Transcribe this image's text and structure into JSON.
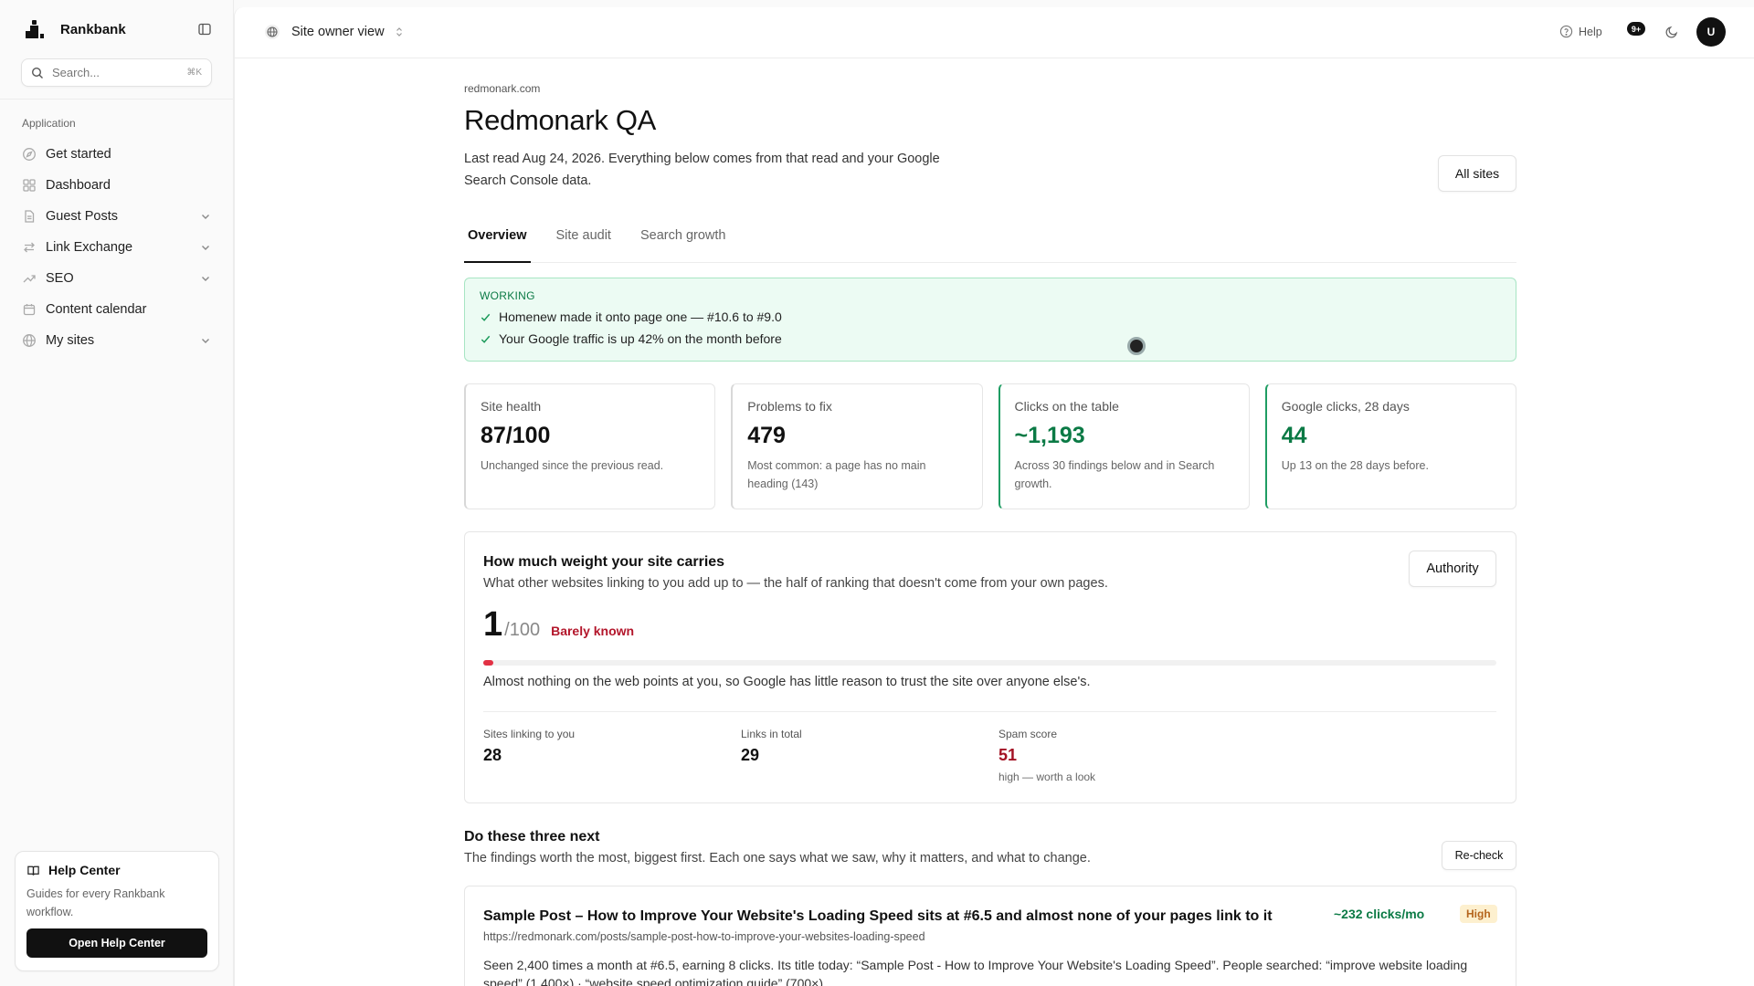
{
  "sidebar": {
    "brand": "Rankbank",
    "search": {
      "placeholder": "Search...",
      "shortcut": "⌘K"
    },
    "group_label": "Application",
    "items": [
      {
        "label": "Get started",
        "icon": "compass-icon",
        "expandable": false
      },
      {
        "label": "Dashboard",
        "icon": "grid-icon",
        "expandable": false
      },
      {
        "label": "Guest Posts",
        "icon": "document-icon",
        "expandable": true
      },
      {
        "label": "Link Exchange",
        "icon": "swap-icon",
        "expandable": true
      },
      {
        "label": "SEO",
        "icon": "trend-up-icon",
        "expandable": true
      },
      {
        "label": "Content calendar",
        "icon": "calendar-icon",
        "expandable": false
      },
      {
        "label": "My sites",
        "icon": "globe-icon",
        "expandable": true
      }
    ],
    "help_card": {
      "title": "Help Center",
      "description": "Guides for every Rankbank workflow.",
      "button": "Open Help Center"
    }
  },
  "topbar": {
    "view_label": "Site owner view",
    "help": "Help",
    "notifications_badge": "9+",
    "avatar_initial": "U"
  },
  "page": {
    "domain": "redmonark.com",
    "title": "Redmonark QA",
    "description": "Last read Aug 24, 2026. Everything below comes from that read and your Google Search Console data.",
    "all_sites_button": "All sites",
    "tabs": [
      {
        "label": "Overview",
        "active": true
      },
      {
        "label": "Site audit",
        "active": false
      },
      {
        "label": "Search growth",
        "active": false
      }
    ]
  },
  "working": {
    "label": "WORKING",
    "items": [
      "Homenew made it onto page one — #10.6 to #9.0",
      "Your Google traffic is up 42% on the month before"
    ]
  },
  "stats": [
    {
      "label": "Site health",
      "value": "87/100",
      "note": "Unchanged since the previous read.",
      "accent": "neutral"
    },
    {
      "label": "Problems to fix",
      "value": "479",
      "note": "Most common: a page has no main heading (143)",
      "accent": "neutral"
    },
    {
      "label": "Clicks on the table",
      "value": "~1,193",
      "note": "Across 30 findings below and in Search growth.",
      "accent": "green"
    },
    {
      "label": "Google clicks, 28 days",
      "value": "44",
      "note": "Up 13 on the 28 days before.",
      "accent": "green"
    }
  ],
  "authority": {
    "title": "How much weight your site carries",
    "description": "What other websites linking to you add up to — the half of ranking that doesn't come from your own pages.",
    "button": "Authority",
    "score": "1",
    "score_max": "/100",
    "score_fraction": 0.01,
    "rating": "Barely known",
    "note": "Almost nothing on the web points at you, so Google has little reason to trust the site over anyone else's.",
    "metrics": [
      {
        "label": "Sites linking to you",
        "value": "28",
        "sub": ""
      },
      {
        "label": "Links in total",
        "value": "29",
        "sub": ""
      },
      {
        "label": "Spam score",
        "value": "51",
        "sub": "high — worth a look"
      }
    ]
  },
  "next": {
    "title": "Do these three next",
    "description": "The findings worth the most, biggest first. Each one says what we saw, why it matters, and what to change.",
    "recheck_button": "Re-check",
    "findings": [
      {
        "title": "Sample Post – How to Improve Your Website's Loading Speed sits at #6.5 and almost none of your pages link to it",
        "url": "https://redmonark.com/posts/sample-post-how-to-improve-your-websites-loading-speed",
        "impact": "~232 clicks/mo",
        "priority": "High",
        "body": "Seen 2,400 times a month at #6.5, earning 8 clicks. Its title today: “Sample Post - How to Improve Your Website's Loading Speed”. People searched: “improve website loading speed” (1,400×) · “website speed optimization guide” (700×)"
      }
    ]
  },
  "colors": {
    "accent_green": "#0b7a45",
    "danger_red": "#b3162b",
    "badge_bg": "#fdf0cf",
    "working_bg": "#ecfbf3"
  }
}
